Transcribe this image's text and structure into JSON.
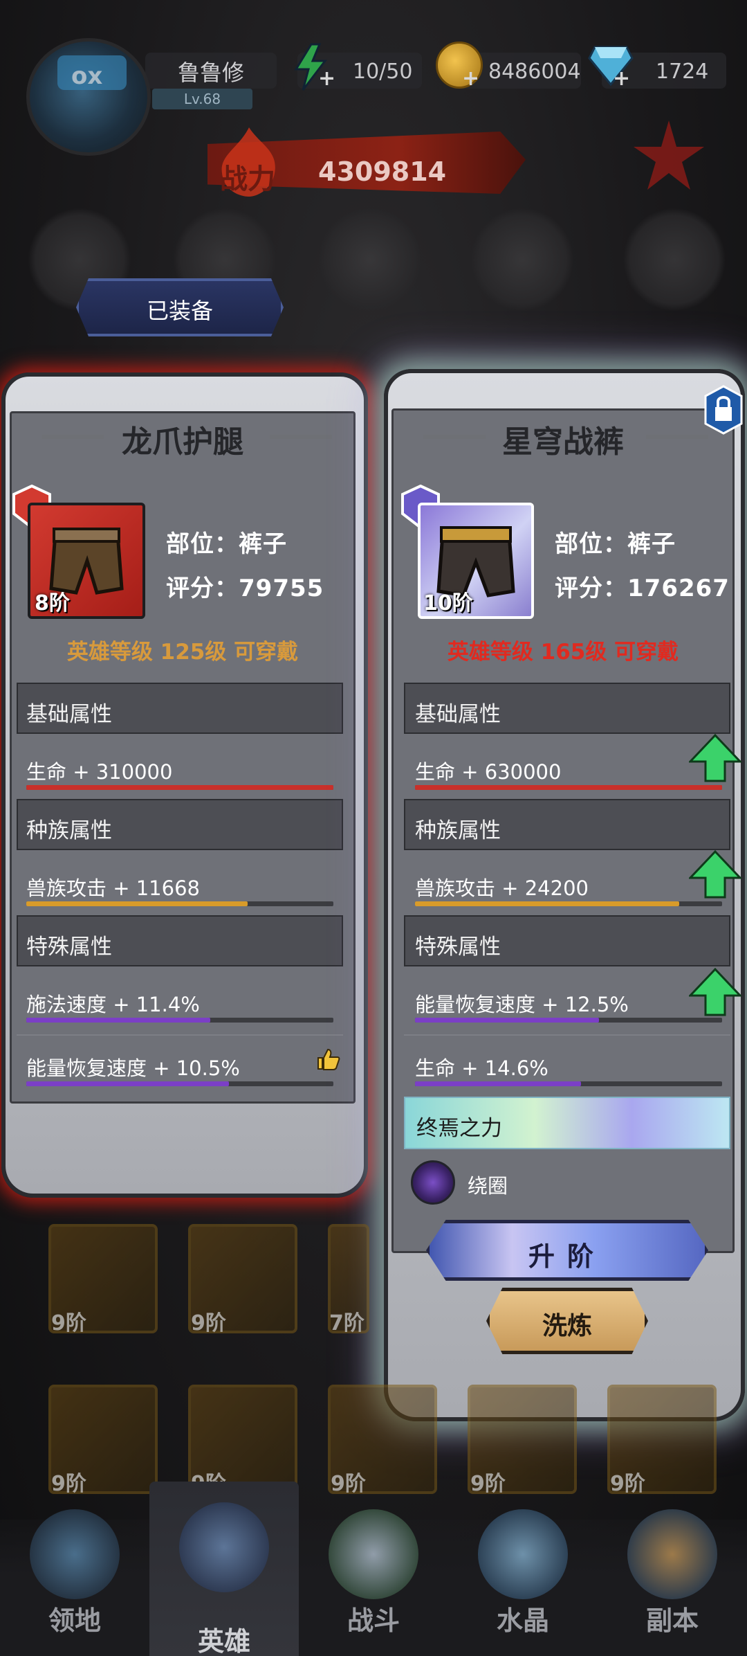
{
  "player": {
    "name": "鲁鲁修",
    "level": "Lv.68"
  },
  "resources": {
    "energy": "10/50",
    "gold": "8486004",
    "gems": "1724"
  },
  "power": {
    "icon_label": "战力",
    "value": "4309814"
  },
  "equipped_tab": "已装备",
  "left_card": {
    "title": "龙爪护腿",
    "tier": "8阶",
    "part": "部位：裤子",
    "score": "评分：79755",
    "requirement": "英雄等级  125级  可穿戴",
    "sections": [
      {
        "label": "基础属性",
        "stats": [
          {
            "text": "生命 + 310000",
            "fill": 1.0,
            "color": "#c8302a"
          }
        ]
      },
      {
        "label": "种族属性",
        "stats": [
          {
            "text": "兽族攻击 + 11668",
            "fill": 0.72,
            "color": "#d89b2a"
          }
        ]
      },
      {
        "label": "特殊属性",
        "stats": [
          {
            "text": "施法速度 + 11.4%",
            "fill": 0.6,
            "color": "#7b3fc6"
          },
          {
            "text": "能量恢复速度 + 10.5%",
            "fill": 0.66,
            "color": "#7b3fc6"
          }
        ]
      }
    ]
  },
  "right_card": {
    "title": "星穹战裤",
    "tier": "10阶",
    "part": "部位：裤子",
    "score": "评分：176267",
    "requirement": "英雄等级  165级  可穿戴",
    "sections": [
      {
        "label": "基础属性",
        "stats": [
          {
            "text": "生命 + 630000",
            "fill": 1.0,
            "color": "#c8302a"
          }
        ]
      },
      {
        "label": "种族属性",
        "stats": [
          {
            "text": "兽族攻击 + 24200",
            "fill": 0.86,
            "color": "#d89b2a"
          }
        ]
      },
      {
        "label": "特殊属性",
        "stats": [
          {
            "text": "能量恢复速度 + 12.5%",
            "fill": 0.6,
            "color": "#7b3fc6"
          },
          {
            "text": "生命 + 14.6%",
            "fill": 0.54,
            "color": "#7b3fc6"
          }
        ]
      }
    ],
    "special_power": "终焉之力",
    "skill_name": "绕圈",
    "upgrade_button": "升阶",
    "refine_button": "洗炼"
  },
  "bottom_grid": [
    {
      "tier": "9阶"
    },
    {
      "tier": "9阶"
    },
    {
      "tier": "7阶"
    },
    {
      "tier": "9阶"
    },
    {
      "tier": "9阶"
    },
    {
      "tier": "9阶"
    },
    {
      "tier": "9阶"
    },
    {
      "tier": "9阶"
    }
  ],
  "nav": [
    {
      "label": "领地"
    },
    {
      "label": "英雄"
    },
    {
      "label": "战斗"
    },
    {
      "label": "水晶"
    },
    {
      "label": "副本"
    }
  ],
  "colors": {
    "requirement_ok": "#d89a3c",
    "requirement_fail": "#e02a20",
    "upgrade_arrow": "#3bd26a"
  }
}
